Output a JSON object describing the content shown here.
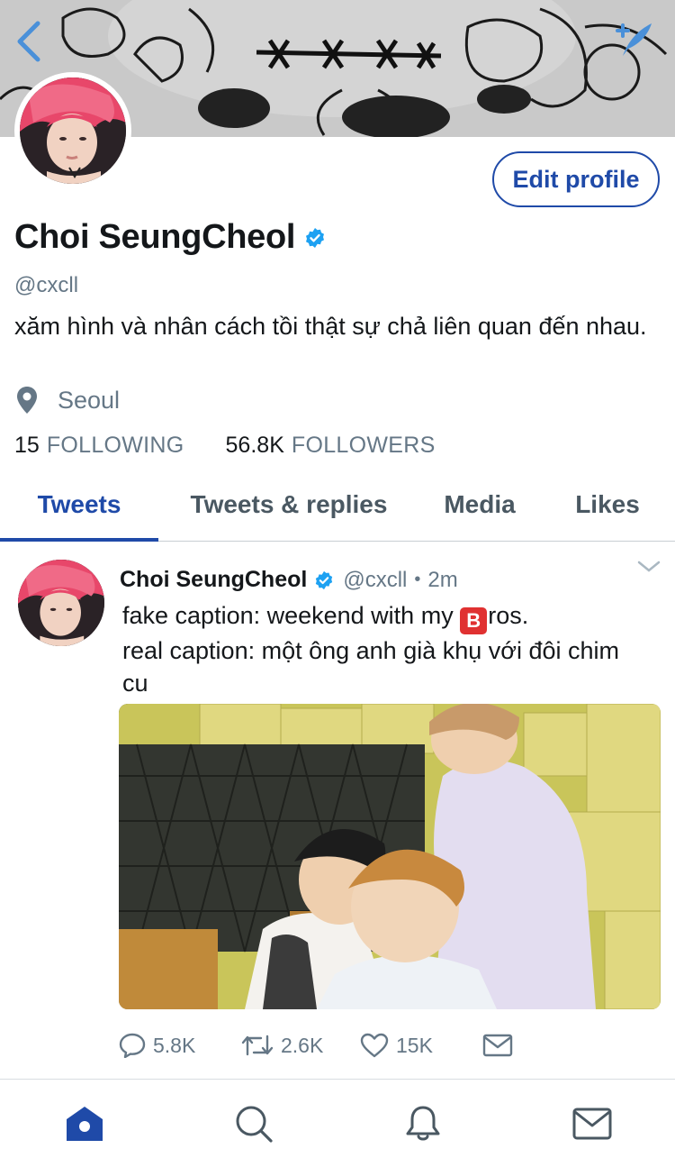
{
  "profile": {
    "name": "Choi SeungCheol",
    "handle": "@cxcll",
    "bio": "xăm hình và nhân cách tồi thật sự chả liên quan đến nhau.",
    "location": "Seoul",
    "edit_label": "Edit profile",
    "following_count": "15",
    "following_label": "FOLLOWING",
    "followers_count": "56.8K",
    "followers_label": "FOLLOWERS"
  },
  "tabs": [
    {
      "label": "Tweets",
      "active": true
    },
    {
      "label": "Tweets & replies",
      "active": false
    },
    {
      "label": "Media",
      "active": false
    },
    {
      "label": "Likes",
      "active": false
    }
  ],
  "tweet": {
    "name": "Choi SeungCheol",
    "handle": "@cxcll",
    "separator": "•",
    "time": "2m",
    "line1_before": "fake caption: weekend with my ",
    "emoji_letter": "B",
    "line1_after": "ros.",
    "line2": "real caption: một ông anh già khụ với đôi chim cu",
    "replies": "5.8K",
    "retweets": "2.6K",
    "likes": "15K"
  },
  "nav": [
    "home-icon",
    "search-icon",
    "notifications-icon",
    "messages-icon"
  ],
  "colors": {
    "accent": "#1f4aa8",
    "verified": "#1da1f2",
    "muted": "#657786",
    "emoji_red": "#e03131"
  }
}
